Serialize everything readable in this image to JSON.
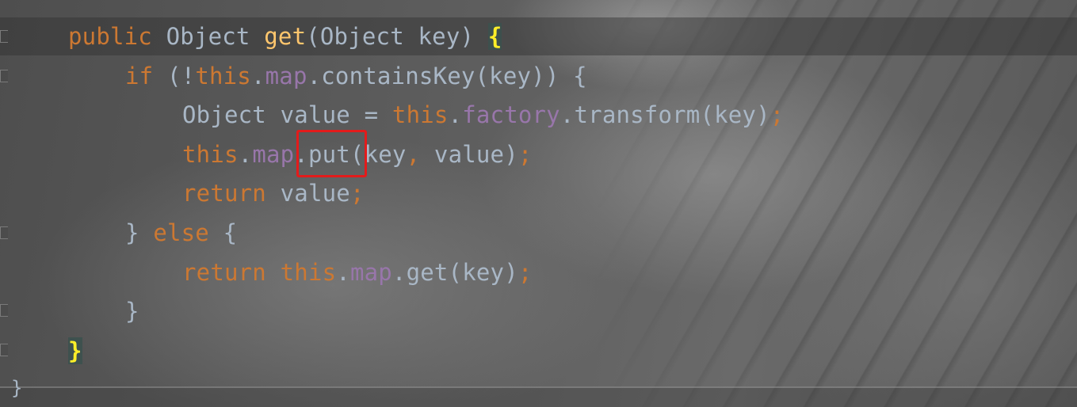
{
  "editor": {
    "lines": [
      {
        "indent": 0,
        "tokens": [
          {
            "t": "public ",
            "c": "keyword"
          },
          {
            "t": "Object ",
            "c": "plain"
          },
          {
            "t": "get",
            "c": "method"
          },
          {
            "t": "(Object key) ",
            "c": "plain"
          },
          {
            "t": "{",
            "c": "brace"
          }
        ]
      },
      {
        "indent": 1,
        "tokens": [
          {
            "t": "if ",
            "c": "keyword"
          },
          {
            "t": "(!",
            "c": "plain"
          },
          {
            "t": "this",
            "c": "keyword"
          },
          {
            "t": ".",
            "c": "plain"
          },
          {
            "t": "map",
            "c": "field"
          },
          {
            "t": ".containsKey(key)) {",
            "c": "plain"
          }
        ]
      },
      {
        "indent": 2,
        "tokens": [
          {
            "t": "Object value = ",
            "c": "plain"
          },
          {
            "t": "this",
            "c": "keyword"
          },
          {
            "t": ".",
            "c": "plain"
          },
          {
            "t": "factory",
            "c": "field"
          },
          {
            "t": ".transform(key)",
            "c": "plain"
          },
          {
            "t": ";",
            "c": "semi"
          }
        ]
      },
      {
        "indent": 2,
        "tokens": [
          {
            "t": "this",
            "c": "keyword"
          },
          {
            "t": ".",
            "c": "plain"
          },
          {
            "t": "map",
            "c": "field"
          },
          {
            "t": ".put(key",
            "c": "plain"
          },
          {
            "t": ", ",
            "c": "semi"
          },
          {
            "t": "value)",
            "c": "plain"
          },
          {
            "t": ";",
            "c": "semi"
          }
        ]
      },
      {
        "indent": 2,
        "tokens": [
          {
            "t": "return ",
            "c": "keyword"
          },
          {
            "t": "value",
            "c": "plain"
          },
          {
            "t": ";",
            "c": "semi"
          }
        ]
      },
      {
        "indent": 1,
        "tokens": [
          {
            "t": "} ",
            "c": "plain"
          },
          {
            "t": "else ",
            "c": "keyword"
          },
          {
            "t": "{",
            "c": "plain"
          }
        ]
      },
      {
        "indent": 2,
        "tokens": [
          {
            "t": "return ",
            "c": "keyword"
          },
          {
            "t": "this",
            "c": "keyword"
          },
          {
            "t": ".",
            "c": "plain"
          },
          {
            "t": "map",
            "c": "field"
          },
          {
            "t": ".get(key)",
            "c": "plain"
          },
          {
            "t": ";",
            "c": "semi"
          }
        ]
      },
      {
        "indent": 1,
        "tokens": [
          {
            "t": "}",
            "c": "plain"
          }
        ]
      },
      {
        "indent": 0,
        "tokens": [
          {
            "t": "}",
            "c": "brace"
          }
        ]
      }
    ],
    "trailing_brace": "}",
    "colors": {
      "keyword": "#cc7832",
      "plain": "#a9b7c6",
      "method": "#ffc66d",
      "field": "#9876aa",
      "brace_highlight": "#ffef28",
      "annotation": "#e31b1b"
    },
    "annotation_target": ".put("
  }
}
